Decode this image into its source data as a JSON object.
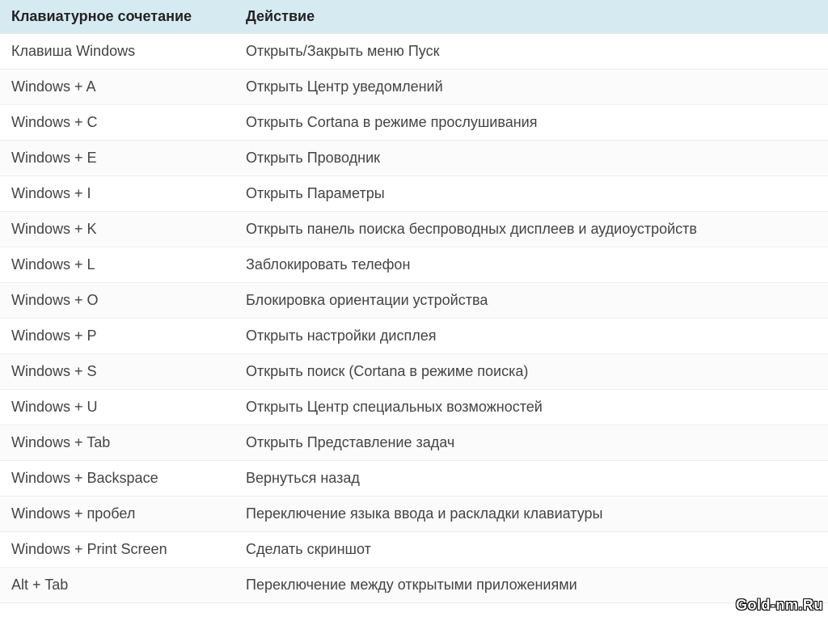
{
  "table": {
    "headers": {
      "shortcut": "Клавиатурное сочетание",
      "action": "Действие"
    },
    "rows": [
      {
        "shortcut": "Клавиша Windows",
        "action": "Открыть/Закрыть меню Пуск"
      },
      {
        "shortcut": "Windows + A",
        "action": "Открыть Центр уведомлений"
      },
      {
        "shortcut": "Windows + C",
        "action": "Открыть Cortana в режиме прослушивания"
      },
      {
        "shortcut": "Windows + E",
        "action": "Открыть Проводник"
      },
      {
        "shortcut": "Windows + I",
        "action": "Открыть Параметры"
      },
      {
        "shortcut": "Windows + K",
        "action": "Открыть панель поиска беспроводных дисплеев и аудиоустройств"
      },
      {
        "shortcut": "Windows + L",
        "action": "Заблокировать телефон"
      },
      {
        "shortcut": "Windows + O",
        "action": "Блокировка ориентации устройства"
      },
      {
        "shortcut": "Windows + P",
        "action": "Открыть настройки дисплея"
      },
      {
        "shortcut": "Windows + S",
        "action": "Открыть поиск (Cortana в режиме поиска)"
      },
      {
        "shortcut": "Windows + U",
        "action": "Открыть Центр специальных возможностей"
      },
      {
        "shortcut": "Windows + Tab",
        "action": "Открыть Представление задач"
      },
      {
        "shortcut": "Windows + Backspace",
        "action": "Вернуться назад"
      },
      {
        "shortcut": "Windows + пробел",
        "action": "Переключение языка ввода и раскладки клавиатуры"
      },
      {
        "shortcut": "Windows + Print Screen",
        "action": "Сделать скриншот"
      },
      {
        "shortcut": "Alt + Tab",
        "action": "Переключение между открытыми приложениями"
      }
    ]
  },
  "watermark": "Gold-nm.Ru"
}
